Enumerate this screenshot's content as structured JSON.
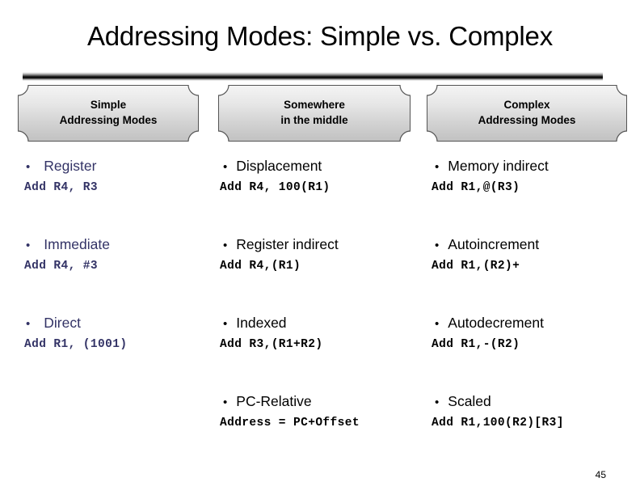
{
  "slide": {
    "title": "Addressing Modes: Simple vs. Complex",
    "page_number": "45",
    "bullet_glyph": "•",
    "colors": {
      "simple_column_text": "#333366",
      "middle_column_text": "#000000",
      "complex_column_text": "#000000",
      "plaque_fill_top": "#f4f4f4",
      "plaque_fill_bottom": "#c2c2c2",
      "plaque_border": "#555555",
      "background": "#ffffff"
    }
  },
  "headers": [
    {
      "id": "simple",
      "line1": "Simple",
      "line2": "Addressing Modes"
    },
    {
      "id": "middle",
      "line1": "Somewhere",
      "line2": "in the middle"
    },
    {
      "id": "complex",
      "line1": "Complex",
      "line2": "Addressing Modes"
    }
  ],
  "columns": [
    {
      "id": "simple",
      "header": "Simple Addressing Modes",
      "entries": [
        {
          "name": "Register",
          "code": "Add R4, R3"
        },
        {
          "name": "Immediate",
          "code": "Add R4, #3"
        },
        {
          "name": "Direct",
          "code": "Add R1, (1001)"
        }
      ]
    },
    {
      "id": "middle",
      "header": "Somewhere in the middle",
      "entries": [
        {
          "name": "Displacement",
          "code": "Add R4, 100(R1)"
        },
        {
          "name": "Register indirect",
          "code": "Add R4,(R1)"
        },
        {
          "name": "Indexed",
          "code": "Add R3,(R1+R2)"
        },
        {
          "name": "PC-Relative",
          "code": "Address = PC+Offset"
        }
      ]
    },
    {
      "id": "complex",
      "header": "Complex Addressing Modes",
      "entries": [
        {
          "name": "Memory indirect",
          "code": "Add R1,@(R3)"
        },
        {
          "name": "Autoincrement",
          "code": "Add R1,(R2)+"
        },
        {
          "name": "Autodecrement",
          "code": "Add R1,-(R2)"
        },
        {
          "name": "Scaled",
          "code": "Add R1,100(R2)[R3]"
        }
      ]
    }
  ]
}
